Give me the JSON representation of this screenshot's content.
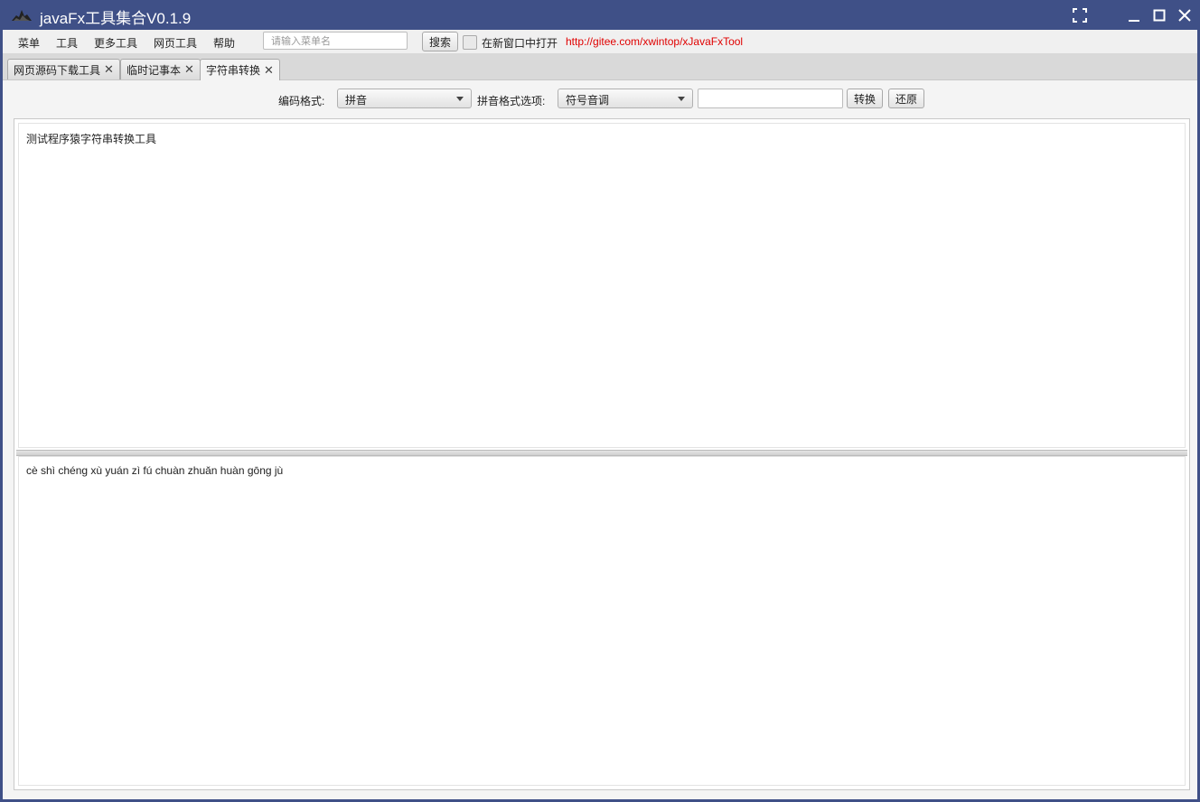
{
  "window": {
    "title": "javaFx工具集合V0.1.9"
  },
  "menubar": {
    "items": [
      "菜单",
      "工具",
      "更多工具",
      "网页工具",
      "帮助"
    ],
    "search_placeholder": "请输入菜单名",
    "search_button": "搜索",
    "new_window_label": "在新窗口中打开",
    "link": "http://gitee.com/xwintop/xJavaFxTool"
  },
  "tabs": [
    {
      "label": "网页源码下载工具",
      "active": false
    },
    {
      "label": "临时记事本",
      "active": false
    },
    {
      "label": "字符串转换",
      "active": true
    }
  ],
  "toolbar": {
    "encoding_label": "编码格式:",
    "encoding_value": "拼音",
    "pinyin_option_label": "拼音格式选项:",
    "pinyin_option_value": "符号音调",
    "input_value": "",
    "convert_button": "转换",
    "restore_button": "还原"
  },
  "editor": {
    "input_text": "测试程序猿字符串转换工具",
    "output_text": "cè shì chéng xù yuán zì fú chuàn zhuǎn huàn gōng jù"
  },
  "colors": {
    "titlebar": "#3f5087",
    "link": "#e00000"
  }
}
